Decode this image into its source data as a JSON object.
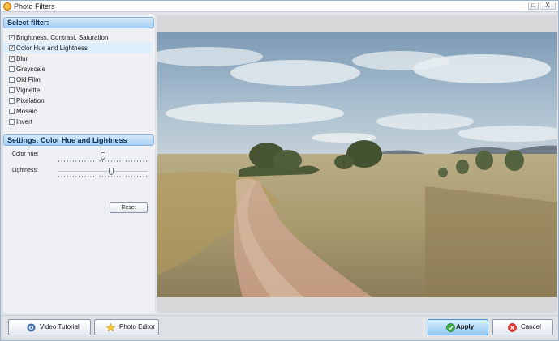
{
  "window": {
    "title": "Photo Filters",
    "maximize_icon": "maximize-icon",
    "close_label": "X",
    "colors": {
      "header_blue": "#a9cff2",
      "apply_blue": "#94c8f2",
      "selected_row": "#ddeefc"
    }
  },
  "filters": {
    "header": "Select filter:",
    "items": [
      {
        "label": "Brightness, Contrast, Saturation",
        "checked": true
      },
      {
        "label": "Color Hue and Lightness",
        "checked": true,
        "selected": true
      },
      {
        "label": "Blur",
        "checked": true
      },
      {
        "label": "Grayscale",
        "checked": false
      },
      {
        "label": "Old Film",
        "checked": false
      },
      {
        "label": "Vignette",
        "checked": false
      },
      {
        "label": "Pixelation",
        "checked": false
      },
      {
        "label": "Mosaic",
        "checked": false
      },
      {
        "label": "Invert",
        "checked": false
      }
    ]
  },
  "settings": {
    "header": "Settings: Color Hue and Lightness",
    "color_hue": {
      "label": "Color hue:",
      "value_fraction": 0.5
    },
    "lightness": {
      "label": "Lightness:",
      "value_fraction": 0.6
    },
    "reset_label": "Reset"
  },
  "preview": {
    "icon": "landscape-photo"
  },
  "buttons": {
    "video_tutorial": {
      "label": "Video Tutorial",
      "icon": "video-tutorial-icon"
    },
    "photo_editor": {
      "label": "Photo Editor",
      "icon": "star-icon"
    },
    "apply": {
      "label": "Apply",
      "icon": "check-circle-icon"
    },
    "cancel": {
      "label": "Cancel",
      "icon": "cancel-circle-icon"
    }
  }
}
